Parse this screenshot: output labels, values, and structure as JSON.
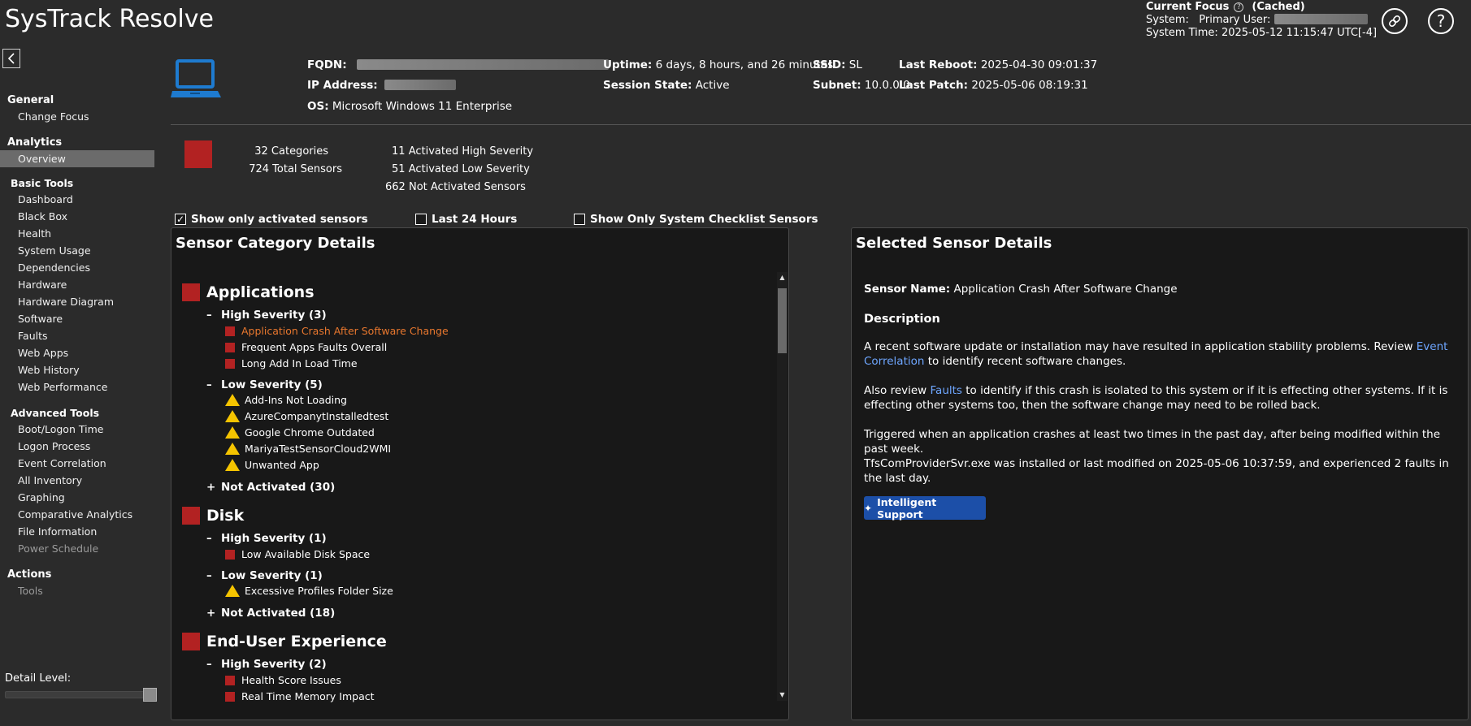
{
  "app": {
    "title": "SysTrack Resolve"
  },
  "focus": {
    "title": "Current Focus",
    "cached": "(Cached)",
    "system_label": "System:",
    "primary_user_label": "Primary User:",
    "system_time_label": "System Time:",
    "system_time": "2025-05-12 11:15:47 UTC[-4]"
  },
  "header_icons": {
    "link": "link-icon",
    "help": "help-icon",
    "collapse": "chevron-left-icon"
  },
  "sidebar": {
    "sections": [
      {
        "title": "General",
        "items": [
          "Change Focus"
        ]
      },
      {
        "title": "Analytics",
        "items": [
          "Overview"
        ]
      },
      {
        "title": "Basic Tools",
        "items": [
          "Dashboard",
          "Black Box",
          "Health",
          "System Usage",
          "Dependencies",
          "Hardware",
          "Hardware Diagram",
          "Software",
          "Faults",
          "Web Apps",
          "Web History",
          "Web Performance"
        ]
      },
      {
        "title": "Advanced Tools",
        "items": [
          "Boot/Logon Time",
          "Logon Process",
          "Event Correlation",
          "All Inventory",
          "Graphing",
          "Comparative Analytics",
          "File Information",
          "Power Schedule"
        ]
      },
      {
        "title": "Actions",
        "items": [
          "Tools"
        ]
      }
    ],
    "detail_level_label": "Detail Level:"
  },
  "system_info": {
    "fqdn_label": "FQDN:",
    "ip_label": "IP Address:",
    "os_label": "OS:",
    "os_value": "Microsoft Windows 11 Enterprise",
    "uptime_label": "Uptime:",
    "uptime_value": "6 days, 8 hours, and 26 minutes",
    "session_label": "Session State:",
    "session_value": "Active",
    "ssid_label": "SSID:",
    "ssid_value": "SL",
    "subnet_label": "Subnet:",
    "subnet_value": "10.0.0.0",
    "reboot_label": "Last Reboot:",
    "reboot_value": "2025-04-30 09:01:37",
    "patch_label": "Last Patch:",
    "patch_value": "2025-05-06 08:19:31"
  },
  "stats": {
    "categories_count": "32",
    "categories_label": "Categories",
    "sensors_count": "724",
    "sensors_label": "Total Sensors",
    "high_count": "11",
    "high_label": "Activated High Severity",
    "low_count": "51",
    "low_label": "Activated Low Severity",
    "not_count": "662",
    "not_label": "Not Activated Sensors"
  },
  "filters": {
    "activated_only": "Show only activated sensors",
    "last24": "Last 24 Hours",
    "checklist_only": "Show Only System Checklist Sensors"
  },
  "category_panel": {
    "title": "Sensor Category Details",
    "categories": [
      {
        "name": "Applications",
        "high": "High Severity (3)",
        "high_items": [
          "Application Crash After Software Change",
          "Frequent Apps Faults Overall",
          "Long Add In Load Time"
        ],
        "low": "Low Severity (5)",
        "low_items": [
          "Add-Ins Not Loading",
          "AzureCompanytInstalledtest",
          "Google Chrome Outdated",
          "MariyaTestSensorCloud2WMI",
          "Unwanted App"
        ],
        "not_activated": "Not Activated (30)"
      },
      {
        "name": "Disk",
        "high": "High Severity (1)",
        "high_items": [
          "Low Available Disk Space"
        ],
        "low": "Low Severity (1)",
        "low_items": [
          "Excessive Profiles Folder Size"
        ],
        "not_activated": "Not Activated (18)"
      },
      {
        "name": "End-User Experience",
        "high": "High Severity (2)",
        "high_items": [
          "Health Score Issues",
          "Real Time Memory Impact"
        ]
      }
    ]
  },
  "detail_panel": {
    "title": "Selected Sensor Details",
    "sensor_name_label": "Sensor Name:",
    "sensor_name": "Application Crash After Software Change",
    "description_label": "Description",
    "p1_a": "A recent software update or installation may have resulted in application stability problems. Review ",
    "p1_link": "Event Correlation",
    "p1_b": " to identify recent software changes.",
    "p2_a": "Also review ",
    "p2_link": "Faults",
    "p2_b": " to identify if this crash is isolated to this system or if it is effecting other systems. If it is effecting other systems too, then the software change may need to be rolled back.",
    "p3": "Triggered when an application crashes at least two times in the past day, after being modified within the past week.",
    "p4": "TfsComProviderSvr.exe was installed or last modified on 2025-05-06 10:37:59, and experienced 2 faults in the last day.",
    "button": "Intelligent Support"
  },
  "colors": {
    "severity_high": "#b22222",
    "severity_low": "#f5c400",
    "selected_item": "#e8772e",
    "link": "#6ea6ff",
    "button": "#1c4fa8"
  }
}
